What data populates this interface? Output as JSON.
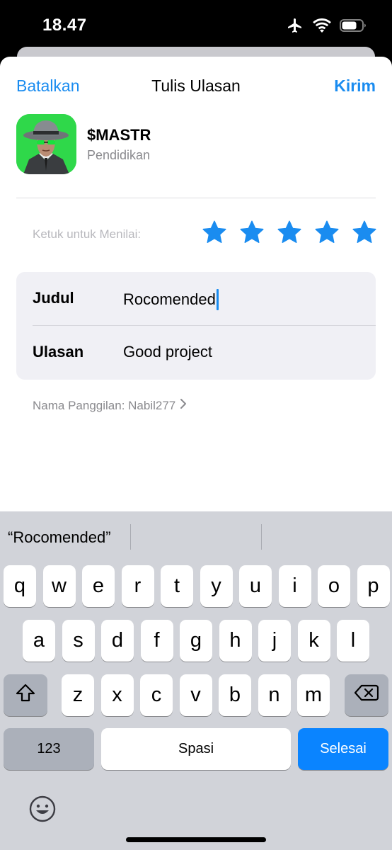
{
  "status_bar": {
    "time": "18.47",
    "icons": [
      "airplane-icon",
      "wifi-icon",
      "battery-icon"
    ]
  },
  "nav": {
    "cancel_label": "Batalkan",
    "title": "Tulis Ulasan",
    "send_label": "Kirim"
  },
  "app": {
    "name": "$MASTR",
    "category": "Pendidikan",
    "icon": "hacker-mascot-icon"
  },
  "rating": {
    "prompt": "Ketuk untuk Menilai:",
    "value": 5,
    "max": 5
  },
  "form": {
    "title_label": "Judul",
    "title_value": "Rocomended",
    "review_label": "Ulasan",
    "review_value": "Good project"
  },
  "nickname": {
    "text": "Nama Panggilan: Nabil277"
  },
  "keyboard": {
    "suggestion": "“Rocomended”",
    "row1": [
      "q",
      "w",
      "e",
      "r",
      "t",
      "y",
      "u",
      "i",
      "o",
      "p"
    ],
    "row2": [
      "a",
      "s",
      "d",
      "f",
      "g",
      "h",
      "j",
      "k",
      "l"
    ],
    "row3": [
      "z",
      "x",
      "c",
      "v",
      "b",
      "n",
      "m"
    ],
    "numbers_label": "123",
    "space_label": "Spasi",
    "done_label": "Selesai"
  },
  "colors": {
    "accent": "#1a8cf0",
    "done_key": "#0a84ff",
    "app_icon_bg": "#2fd84a",
    "keyboard_bg": "#d1d3d9"
  }
}
